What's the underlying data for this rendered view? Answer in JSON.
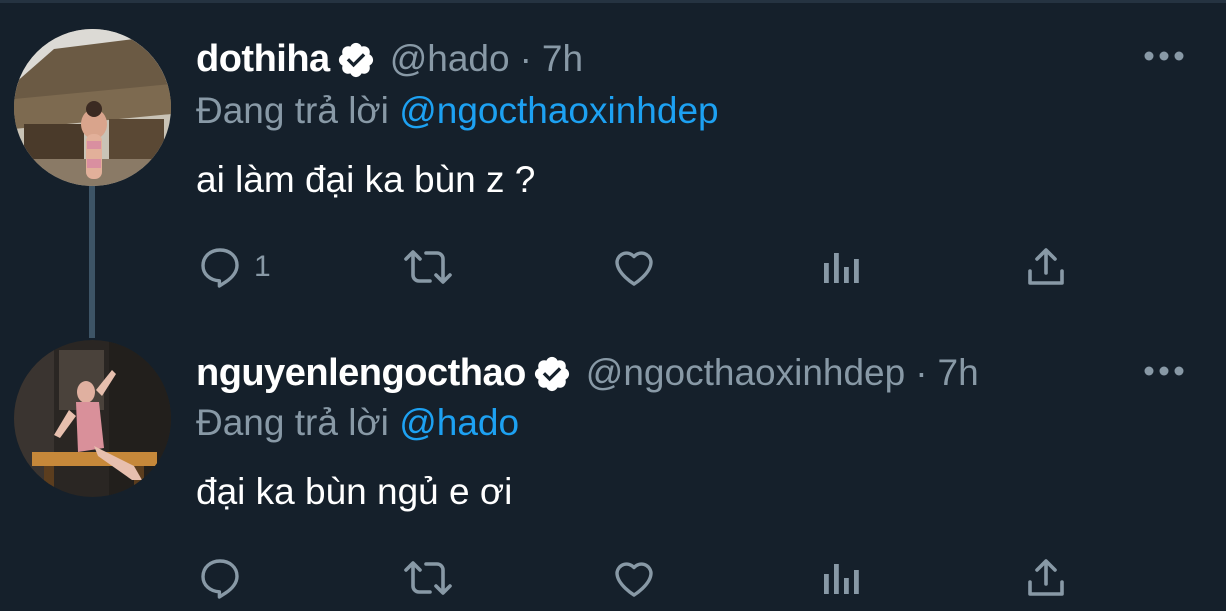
{
  "tweets": [
    {
      "name": "dothiha",
      "verified": true,
      "handle": "@hado",
      "separator": "·",
      "time": "7h",
      "reply_prefix": "Đang trả lời",
      "reply_mention": "@ngocthaoxinhdep",
      "text": "ai làm đại ka bùn z ?",
      "reply_count": "1",
      "retweet_count": "",
      "like_count": ""
    },
    {
      "name": "nguyenlengocthao",
      "verified": true,
      "handle": "@ngocthaoxinhdep",
      "separator": "·",
      "time": "7h",
      "reply_prefix": "Đang trả lời",
      "reply_mention": "@hado",
      "text": "đại ka bùn ngủ e ơi",
      "reply_count": "",
      "retweet_count": "",
      "like_count": ""
    }
  ],
  "icons": {
    "verified": "verified-badge-icon",
    "more": "more-dots-icon",
    "reply": "reply-bubble-icon",
    "retweet": "retweet-icon",
    "like": "heart-icon",
    "analytics": "analytics-bars-icon",
    "share": "share-upload-icon"
  },
  "colors": {
    "background": "#15202b",
    "secondary_text": "#8899a6",
    "mention": "#1da1f2",
    "thread_line": "#3d5466"
  }
}
